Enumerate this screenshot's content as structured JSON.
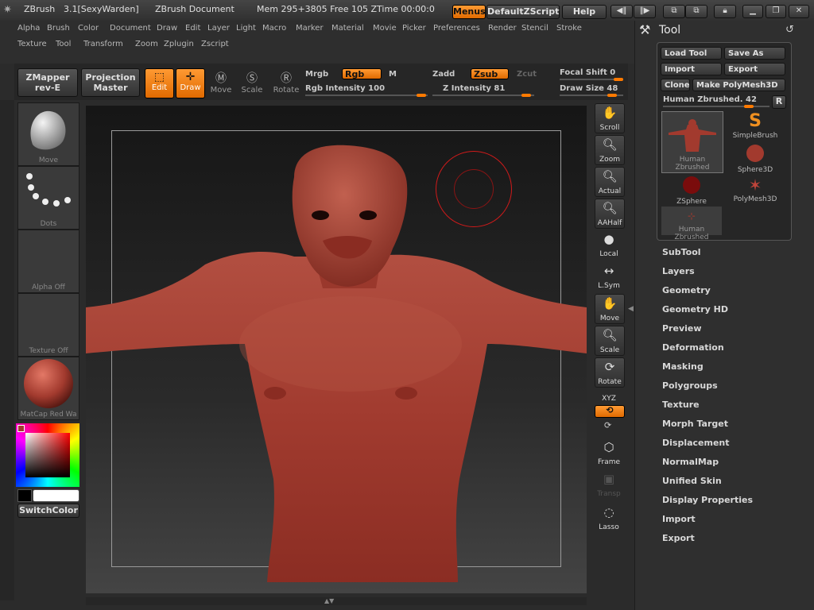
{
  "titlebar": {
    "app": "ZBrush",
    "version": "3.1[SexyWarden]",
    "document": "ZBrush Document",
    "mem": "Mem 295+3805 Free 105 ZTime 00:00:0",
    "menus_label": "Menus",
    "default_zscript": "DefaultZScript",
    "help": "Help"
  },
  "menus_row1": [
    "Alpha",
    "Brush",
    "Color",
    "Document",
    "Draw",
    "Edit",
    "Layer",
    "Light",
    "Macro",
    "Marker",
    "Material",
    "Movie",
    "Picker",
    "Preferences",
    "Render",
    "Stencil",
    "Stroke"
  ],
  "menus_row2": [
    "Texture",
    "Tool",
    "Transform",
    "Zoom",
    "Zplugin",
    "Zscript"
  ],
  "shelf": {
    "zmapper_line1": "ZMapper",
    "zmapper_line2": "rev-E",
    "projection_line1": "Projection",
    "projection_line2": "Master",
    "edit": "Edit",
    "draw": "Draw",
    "move": "Move",
    "scale": "Scale",
    "rotate": "Rotate",
    "mrgb": "Mrgb",
    "rgb": "Rgb",
    "m": "M",
    "zadd": "Zadd",
    "zsub": "Zsub",
    "zcut": "Zcut",
    "rgb_intensity": "Rgb Intensity 100",
    "z_intensity": "Z Intensity 81",
    "focal_shift": "Focal Shift 0",
    "draw_size": "Draw Size 48"
  },
  "left_tray": {
    "move": "Move",
    "dots": "Dots",
    "alpha_off": "Alpha Off",
    "texture_off": "Texture Off",
    "matcap": "MatCap Red Wa",
    "switch_color": "SwitchColor"
  },
  "dock": [
    "Scroll",
    "Zoom",
    "Actual",
    "AAHalf",
    "Local",
    "L.Sym",
    "Move",
    "Scale",
    "Rotate",
    "XYZ",
    "Frame",
    "Transp",
    "Lasso"
  ],
  "tool_panel": {
    "title": "Tool",
    "load_tool": "Load Tool",
    "save_as": "Save As",
    "import": "Import",
    "export": "Export",
    "clone": "Clone",
    "make_polymesh": "Make PolyMesh3D",
    "current": "Human Zbrushed. 42",
    "r": "R",
    "tools": [
      "Human Zbrushed",
      "SimpleBrush",
      "Sphere3D",
      "ZSphere",
      "PolyMesh3D",
      "Human Zbrushed"
    ],
    "sections": [
      "SubTool",
      "Layers",
      "Geometry",
      "Geometry HD",
      "Preview",
      "Deformation",
      "Masking",
      "Polygroups",
      "Texture",
      "Morph Target",
      "Displacement",
      "NormalMap",
      "Unified Skin",
      "Display Properties",
      "Import",
      "Export"
    ]
  },
  "colors": {
    "accent": "#ff7a00",
    "model": "#a23a2e",
    "bg": "#2b2b2b"
  }
}
